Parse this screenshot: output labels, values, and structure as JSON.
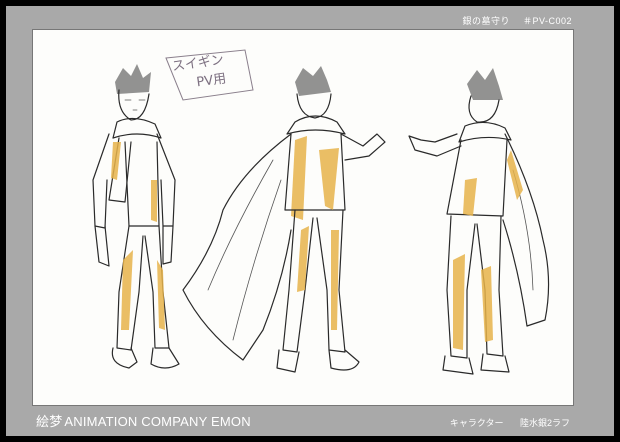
{
  "header": {
    "title": "銀の墓守り",
    "code": "＃PV-C002"
  },
  "memo": {
    "line1": "スイギン",
    "line2": "PV用"
  },
  "footer": {
    "company_kanji": "絵梦",
    "company_name": "ANIMATION COMPANY EMON",
    "category": "キャラクター",
    "character": "陸水銀2ラフ"
  },
  "colors": {
    "border": "#000000",
    "frame": "#a9a9a9",
    "paper": "#fdfdfb",
    "tone": "#e6b34a"
  }
}
